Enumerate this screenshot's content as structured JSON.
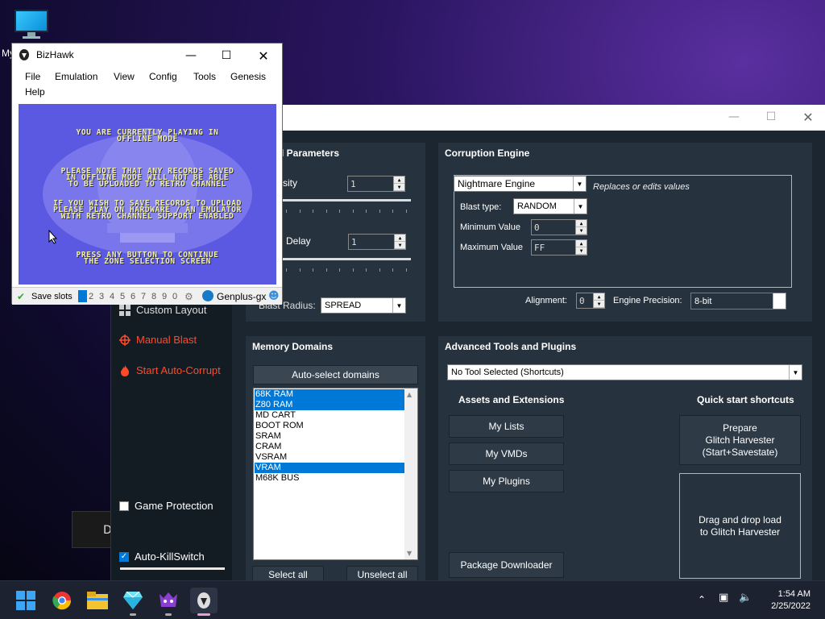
{
  "desktop": {
    "icon_label": "My"
  },
  "bizhawk": {
    "title": "BizHawk",
    "menu": [
      "File",
      "Emulation",
      "View",
      "Config",
      "Tools",
      "Genesis",
      "Help"
    ],
    "screen_lines": [
      "YOU ARE CURRENTLY PLAYING IN",
      "OFFLINE MODE",
      "PLEASE NOTE THAT ANY RECORDS SAVED",
      "IN OFFLINE MODE WILL NOT BE ABLE",
      "TO BE UPLOADED TO RETRO CHANNEL",
      "IF YOU WISH TO SAVE RECORDS TO UPLOAD",
      "PLEASE PLAY ON HARDWARE / AN EMULATOR",
      "WITH RETRO CHANNEL SUPPORT ENABLED",
      "PRESS ANY BUTTON TO CONTINUE",
      "THE ZONE SELECTION SCREEN"
    ],
    "status": {
      "save_slots_label": "Save slots",
      "slots": [
        "1",
        "2",
        "3",
        "4",
        "5",
        "6",
        "7",
        "8",
        "9",
        "0"
      ],
      "core": "Genplus-gx"
    }
  },
  "rtc": {
    "sidebar": {
      "custom_layout": "Custom Layout",
      "manual_blast": "Manual Blast",
      "start_auto_corrupt": "Start Auto-Corrupt",
      "game_protection": "Game Protection",
      "game_protection_checked": false,
      "auto_killswitch": "Auto-KillSwitch",
      "auto_killswitch_checked": true
    },
    "general_params": {
      "header": "l Parameters",
      "intensity_label": "sity",
      "intensity_value": "1",
      "delay_label": "Delay",
      "delay_value": "1",
      "blast_radius_label": "Blast Radius:",
      "blast_radius_value": "SPREAD"
    },
    "engine": {
      "header": "Corruption Engine",
      "engine_value": "Nightmare Engine",
      "engine_desc": "Replaces or edits values",
      "blast_type_label": "Blast type:",
      "blast_type_value": "RANDOM",
      "min_label": "Minimum Value",
      "min_value": "0",
      "max_label": "Maximum Value",
      "max_value": "FF",
      "alignment_label": "Alignment:",
      "alignment_value": "0",
      "precision_label": "Engine Precision:",
      "precision_value": "8-bit"
    },
    "memory": {
      "header": "Memory Domains",
      "auto_select": "Auto-select domains",
      "domains": [
        "68K RAM",
        "Z80 RAM",
        "MD CART",
        "BOOT ROM",
        "SRAM",
        "CRAM",
        "VSRAM",
        "VRAM",
        "M68K BUS"
      ],
      "selected": [
        true,
        true,
        false,
        false,
        false,
        false,
        false,
        true,
        false
      ],
      "select_all": "Select all",
      "unselect_all": "Unselect all"
    },
    "advanced": {
      "header": "Advanced Tools and Plugins",
      "tool_select": "No Tool Selected (Shortcuts)",
      "assets_header": "Assets and Extensions",
      "my_lists": "My Lists",
      "my_vmds": "My VMDs",
      "my_plugins": "My Plugins",
      "package_downloader": "Package Downloader",
      "quick_header": "Quick start shortcuts",
      "prepare": "Prepare\nGlitch Harvester\n(Start+Savestate)",
      "drag_drop": "Drag and drop load\nto Glitch Harvester"
    }
  },
  "taskbar": {
    "time": "1:54 AM",
    "date": "2/25/2022",
    "partial_label": "D"
  },
  "colors": {
    "accent_red": "#ff4a2a",
    "selection_blue": "#0078d7",
    "panel": "#26323d"
  }
}
